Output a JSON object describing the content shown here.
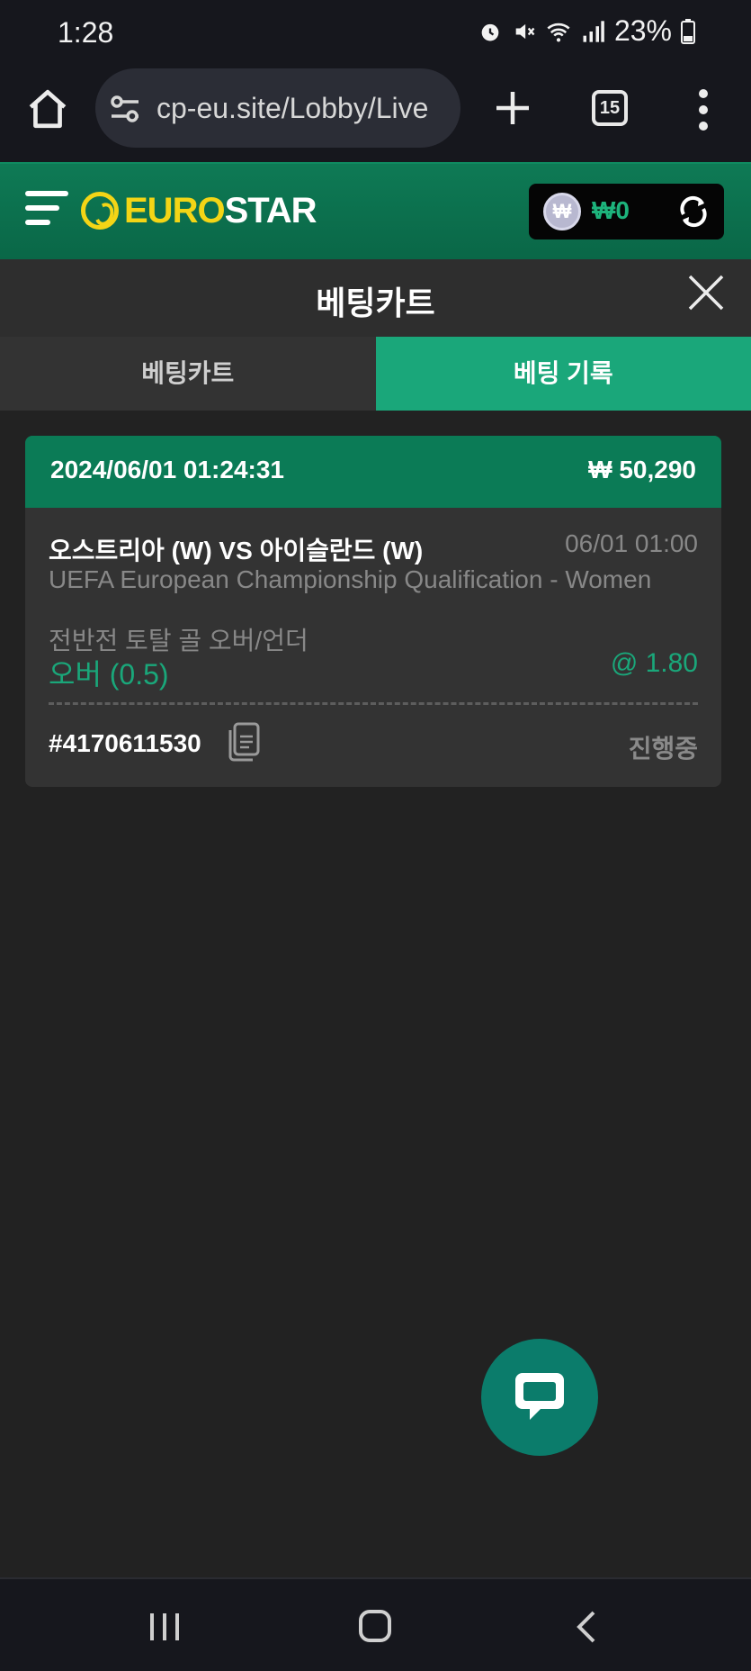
{
  "status_bar": {
    "time": "1:28",
    "battery": "23%"
  },
  "browser": {
    "url": "cp-eu.site/Lobby/Live",
    "tab_count": "15"
  },
  "header": {
    "logo_euro": "EURO",
    "logo_star": "STAR",
    "balance": "₩0",
    "coin_symbol": "₩"
  },
  "panel": {
    "title": "베팅카트"
  },
  "tabs": [
    {
      "label": "베팅카트",
      "active": false
    },
    {
      "label": "베팅 기록",
      "active": true
    }
  ],
  "bet": {
    "datetime": "2024/06/01 01:24:31",
    "amount": "₩ 50,290",
    "match": "오스트리아 (W) VS 아이슬란드 (W)",
    "match_time": "06/01 01:00",
    "league": "UEFA European Championship Qualification - Women",
    "market": "전반전 토탈 골 오버/언더",
    "selection": "오버 (0.5)",
    "odds": "@ 1.80",
    "bet_id": "#4170611530",
    "status": "진행중"
  },
  "colors": {
    "accent": "#1aa77a",
    "header_green": "#0b7b56",
    "logo_yellow": "#f3d516",
    "background": "#222222"
  },
  "icons": [
    "home-icon",
    "tune-icon",
    "plus-icon",
    "tabs-icon",
    "more-vert-icon",
    "menu-icon",
    "coin-icon",
    "refresh-icon",
    "close-icon",
    "copy-icon",
    "chat-icon"
  ]
}
